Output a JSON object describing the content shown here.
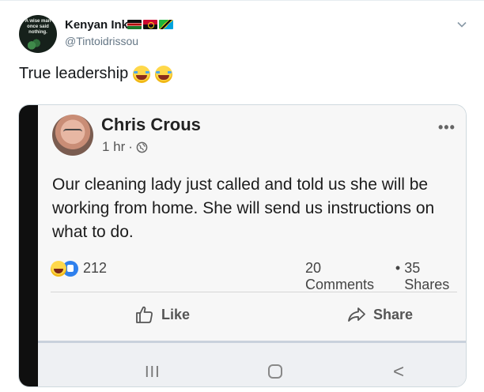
{
  "tweet": {
    "author_name": "Kenyan Ink",
    "author_handle": "@Tintoidrissou",
    "avatar_text": "A wise man once said nothing.",
    "flags": [
      "kenya-flag",
      "angola-flag",
      "tanzania-flag"
    ],
    "text": "True leadership",
    "emojis": [
      "face-with-tears-of-joy",
      "face-with-tears-of-joy"
    ],
    "menu_icon": "chevron-down-icon"
  },
  "facebook_post": {
    "author_name": "Chris Crous",
    "time": "1 hr",
    "time_separator": "·",
    "visibility_icon": "globe-icon",
    "more_icon": "more-dots-icon",
    "more_label": "•••",
    "body": "Our cleaning lady just called and told us she will be working from home. She will send us instructions on what to do.",
    "reactions_count": "212",
    "reaction_icons": [
      "haha-reaction-icon",
      "like-reaction-icon"
    ],
    "comments": "20 Comments",
    "stats_separator": "•",
    "shares": "35 Shares",
    "like_label": "Like",
    "share_label": "Share"
  },
  "android_nav": {
    "recent_label": "III",
    "back_label": "<"
  },
  "colors": {
    "tweet_text": "#14171a",
    "handle": "#657786",
    "divider": "#e6ecf0",
    "like_blue": "#2f80ed"
  }
}
